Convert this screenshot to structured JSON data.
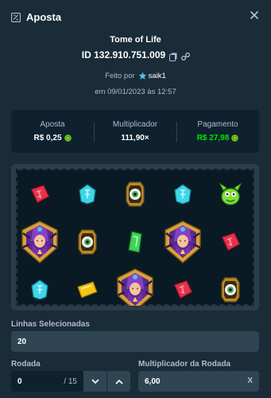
{
  "header": {
    "title": "Aposta",
    "close_icon": "close-icon"
  },
  "bet": {
    "game_name": "Tome of Life",
    "bet_id": "ID 132.910.751.009",
    "placed_by_prefix": "Feito por",
    "username": "saik1",
    "date": "em 09/01/2023 às 12:57"
  },
  "stats": {
    "bet_label": "Aposta",
    "bet_value": "R$ 0,25",
    "multiplier_label": "Multiplicador",
    "multiplier_value": "111,90×",
    "payout_label": "Pagamento",
    "payout_value": "R$ 27,98"
  },
  "reels": [
    [
      "red-rune",
      "witch-wild",
      "cyan-rune"
    ],
    [
      "cyan-rune",
      "eye-lantern",
      "yellow-gem"
    ],
    [
      "eye-lantern",
      "green-gem",
      "witch-wild"
    ],
    [
      "cyan-rune",
      "witch-wild",
      "red-rune"
    ],
    [
      "green-creature",
      "red-rune",
      "eye-lantern"
    ]
  ],
  "form": {
    "lines_label": "Linhas Selecionadas",
    "lines_value": "20",
    "round_label": "Rodada",
    "round_value": "0",
    "round_total": "/ 15",
    "round_multiplier_label": "Multiplicador da Rodada",
    "round_multiplier_value": "6,00",
    "clear_label": "X"
  },
  "colors": {
    "background": "#1a2c38",
    "panel": "#0f212e",
    "input": "#2f4553",
    "muted": "#b1bad3",
    "payout_green": "#00e701"
  }
}
